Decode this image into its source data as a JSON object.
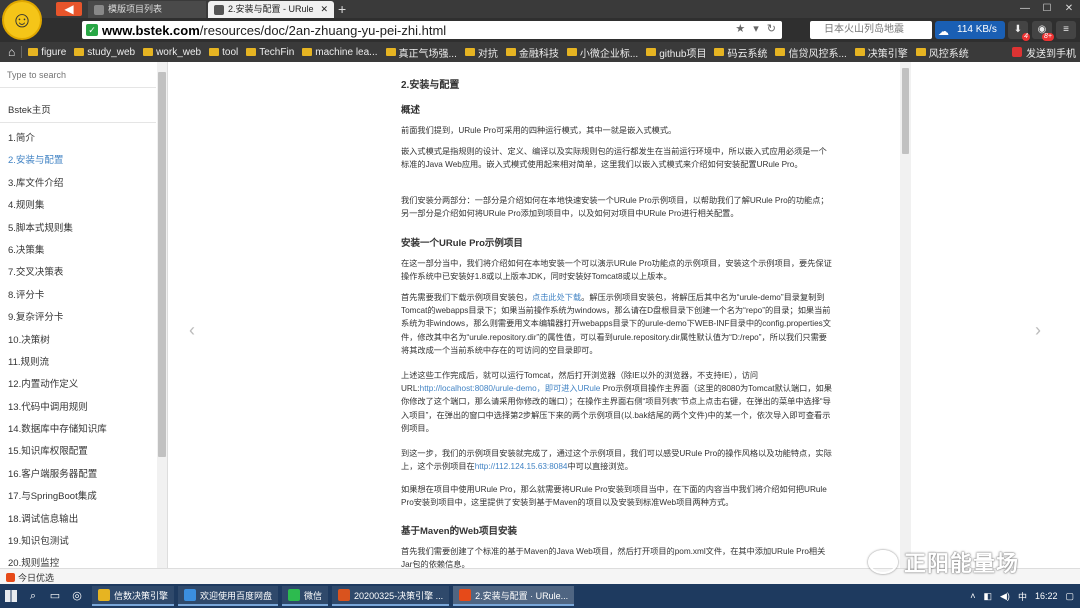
{
  "browser": {
    "tabs": [
      {
        "title": "模版项目列表",
        "active": false
      },
      {
        "title": "2.安装与配置 - URule",
        "active": true
      }
    ],
    "url_domain": "www.bstek.com",
    "url_path": "/resources/doc/2an-zhuang-yu-pei-zhi.html",
    "search_placeholder": "日本火山列岛地震",
    "speed_text": "114 KB/s",
    "toolbar_badges": [
      "4",
      "8+"
    ]
  },
  "bookmarks": [
    "figure",
    "study_web",
    "work_web",
    "tool",
    "TechFin",
    "machine lea...",
    "真正气场强...",
    "对抗",
    "金融科技",
    "小微企业标...",
    "github项目",
    "码云系统",
    "信贷风控系...",
    "决策引擎",
    "风控系统"
  ],
  "bookmarks_right": "发送到手机",
  "sidebar": {
    "search_placeholder": "Type to search",
    "home_label": "Bstek主页",
    "items": [
      {
        "label": "1.简介",
        "active": false
      },
      {
        "label": "2.安装与配置",
        "active": true
      },
      {
        "label": "3.库文件介绍",
        "active": false
      },
      {
        "label": "4.规则集",
        "active": false
      },
      {
        "label": "5.脚本式规则集",
        "active": false
      },
      {
        "label": "6.决策集",
        "active": false
      },
      {
        "label": "7.交叉决策表",
        "active": false
      },
      {
        "label": "8.评分卡",
        "active": false
      },
      {
        "label": "9.复杂评分卡",
        "active": false
      },
      {
        "label": "10.决策树",
        "active": false
      },
      {
        "label": "11.规则流",
        "active": false
      },
      {
        "label": "12.内置动作定义",
        "active": false
      },
      {
        "label": "13.代码中调用规则",
        "active": false
      },
      {
        "label": "14.数据库中存储知识库",
        "active": false
      },
      {
        "label": "15.知识库权限配置",
        "active": false
      },
      {
        "label": "16.客户端服务器配置",
        "active": false
      },
      {
        "label": "17.与SpringBoot集成",
        "active": false
      },
      {
        "label": "18.调试信息输出",
        "active": false
      },
      {
        "label": "19.知识包测试",
        "active": false
      },
      {
        "label": "20.规则监控",
        "active": false
      }
    ]
  },
  "article": {
    "title": "2.安装与配置",
    "h_overview": "概述",
    "p1": "前面我们提到，URule Pro可采用的四种运行模式，其中一就是嵌入式模式。",
    "p2": "嵌入式模式是指规则的设计、定义、编译以及实际规则包的运行都发生在当前运行环境中，所以嵌入式应用必须是一个标准的Java Web应用。嵌入式模式使用起来相对简单，这里我们以嵌入式模式来介绍如何安装配置URule Pro。",
    "p3": "我们安装分两部分：一部分是介绍如何在本地快速安装一个URule Pro示例项目，以帮助我们了解URule Pro的功能点；另一部分是介绍如何将URule Pro添加到项目中，以及如何对项目中URule Pro进行相关配置。",
    "h_install": "安装一个URule Pro示例项目",
    "p4": "在这一部分当中，我们将介绍如何在本地安装一个可以演示URule Pro功能点的示例项目，安装这个示例项目，要先保证操作系统中已安装好1.8或以上版本JDK，同时安装好Tomcat8或以上版本。",
    "p5_a": "首先需要我们下载示例项目安装包，",
    "p5_link": "点击此处下载",
    "p5_b": "。解压示例项目安装包，将解压后其中名为“urule-demo”目录复制到Tomcat的webapps目录下；如果当前操作系统为windows，那么请在D盘根目录下创建一个名为“repo”的目录；如果当前系统为非windows，那么则需要用文本编辑器打开webapps目录下的urule-demo下WEB-INF目录中的config.properties文件，修改其中名为“urule.repository.dir”的属性值，可以看到urule.repository.dir属性默认值为“D:/repo”，所以我们只需要将其改成一个当前系统中存在的可访问的空目录即可。",
    "p6_a": "上述这些工作完成后，就可以运行Tomcat，然后打开浏览器（除IE以外的浏览器，不支持IE），访问URL:",
    "p6_link": "http://localhost:8080/urule-demo，即可进入URule",
    "p6_b": " Pro示例项目操作主界面（这里的8080为Tomcat默认端口，如果你修改了这个端口，那么请采用你修改的端口）；在操作主界面右侧“项目列表”节点上点击右键，在弹出的菜单中选择“导入项目”，在弹出的窗口中选择第2步解压下来的两个示例项目(以.bak结尾的两个文件)中的某一个，依次导入即可查看示例项目。",
    "p7_a": "到这一步，我们的示例项目安装就完成了，通过这个示例项目，我们可以感受URule Pro的操作风格以及功能特点，实际上，这个示例项目在",
    "p7_link": "http://112.124.15.63:8084",
    "p7_b": "中可以直接浏览。",
    "p8": "如果想在项目中使用URule Pro，那么就需要将URule Pro安装到项目当中，在下面的内容当中我们将介绍如何把URule Pro安装到项目中，这里提供了安装到基于Maven的项目以及安装到标准Web项目两种方式。",
    "h_maven": "基于Maven的Web项目安装",
    "p9": "首先我们需要创建了个标准的基于Maven的Java Web项目，然后打开项目的pom.xml文件，在其中添加URule Pro相关Jar包的依赖信息。"
  },
  "statusbar": {
    "today_label": "今日优选"
  },
  "watermark": "正阳能量场",
  "taskbar": {
    "apps": [
      {
        "label": "信数决策引擎",
        "color": "#e6b422",
        "active": false
      },
      {
        "label": "欢迎使用百度网盘",
        "color": "#3b8fe0",
        "active": false
      },
      {
        "label": "微信",
        "color": "#2dbb4f",
        "active": false
      },
      {
        "label": "20200325-决策引擎 ...",
        "color": "#d9531e",
        "active": false
      },
      {
        "label": "2.安装与配置 · URule...",
        "color": "#e64a19",
        "active": true
      }
    ],
    "clock": "16:22"
  },
  "colors": {
    "link": "#4183c4",
    "active_nav": "#4183c4",
    "taskbar": "#1e3a5f"
  }
}
